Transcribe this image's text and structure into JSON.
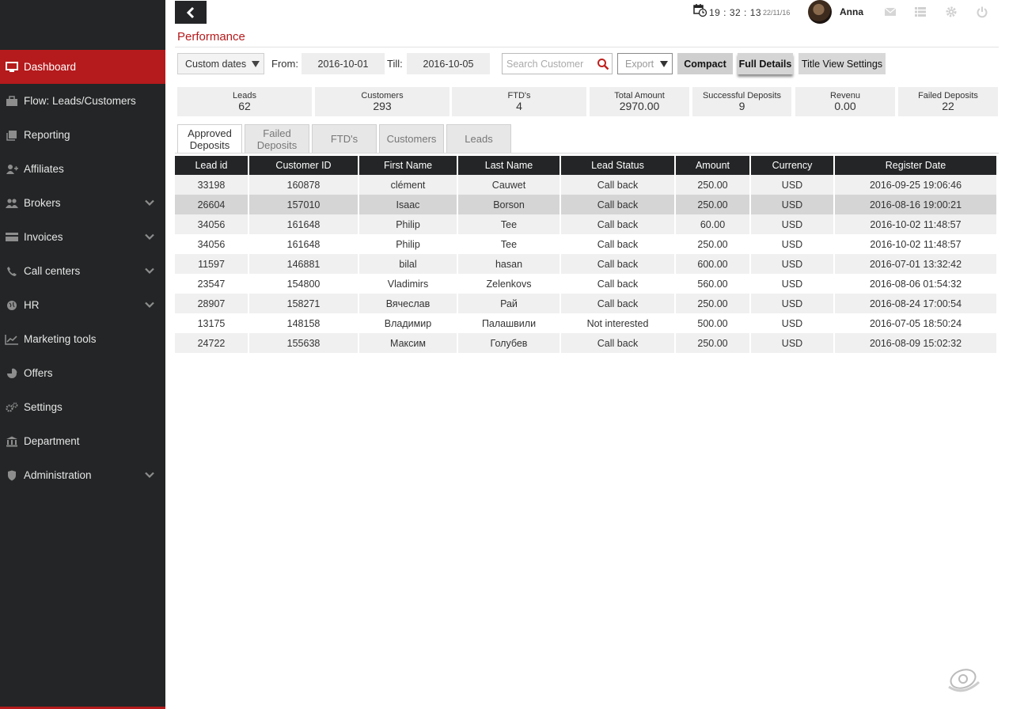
{
  "sidebar": {
    "items": [
      {
        "label": "Dashboard",
        "icon": "monitor-icon",
        "active": true,
        "expandable": false
      },
      {
        "label": "Flow: Leads/Customers",
        "icon": "briefcase-icon",
        "expandable": false
      },
      {
        "label": "Reporting",
        "icon": "book-icon",
        "expandable": false
      },
      {
        "label": "Affiliates",
        "icon": "user-plus-icon",
        "expandable": false
      },
      {
        "label": "Brokers",
        "icon": "users-icon",
        "expandable": true
      },
      {
        "label": "Invoices",
        "icon": "credit-card-icon",
        "expandable": true
      },
      {
        "label": "Call centers",
        "icon": "phone-icon",
        "expandable": true
      },
      {
        "label": "HR",
        "icon": "globe-icon",
        "expandable": true
      },
      {
        "label": "Marketing tools",
        "icon": "line-chart-icon",
        "expandable": false
      },
      {
        "label": "Offers",
        "icon": "pie-chart-icon",
        "expandable": false
      },
      {
        "label": "Settings",
        "icon": "gears-icon",
        "expandable": false
      },
      {
        "label": "Department",
        "icon": "bank-icon",
        "expandable": false
      },
      {
        "label": "Administration",
        "icon": "shield-icon",
        "expandable": true
      }
    ]
  },
  "header": {
    "time": "19 : 32 : 13",
    "date": "22/11/16",
    "username": "Anna",
    "icons": [
      "calendar-clock-icon",
      "mail-icon",
      "list-icon",
      "gear-icon",
      "power-icon"
    ]
  },
  "page": {
    "title": "Performance"
  },
  "filters": {
    "range_select": "Custom dates",
    "from_label": "From:",
    "from_value": "2016-10-01",
    "till_label": "Till:",
    "till_value": "2016-10-05",
    "search_placeholder": "Search Customer",
    "export_label": "Export",
    "compact_label": "Compact",
    "full_details_label": "Full Details",
    "title_view_label": "Title View Settings"
  },
  "stats": [
    {
      "label": "Leads",
      "value": "62"
    },
    {
      "label": "Customers",
      "value": "293"
    },
    {
      "label": "FTD's",
      "value": "4"
    },
    {
      "label": "Total Amount",
      "value": "2970.00"
    },
    {
      "label": "Successful Deposits",
      "value": "9"
    },
    {
      "label": "Revenu",
      "value": "0.00"
    },
    {
      "label": "Failed Deposits",
      "value": "22"
    }
  ],
  "tabs": [
    {
      "line1": "Approved",
      "line2": "Deposits",
      "active": true
    },
    {
      "line1": "Failed",
      "line2": "Deposits",
      "active": false
    },
    {
      "line1": "FTD's",
      "line2": "",
      "active": false
    },
    {
      "line1": "Customers",
      "line2": "",
      "active": false
    },
    {
      "line1": "Leads",
      "line2": "",
      "active": false
    }
  ],
  "table": {
    "columns": [
      "Lead id",
      "Customer ID",
      "First Name",
      "Last Name",
      "Lead Status",
      "Amount",
      "Currency",
      "Register Date"
    ],
    "rows": [
      [
        "33198",
        "160878",
        "clément",
        "Cauwet",
        "Call back",
        "250.00",
        "USD",
        "2016-09-25 19:06:46"
      ],
      [
        "26604",
        "157010",
        "Isaac",
        "Borson",
        "Call back",
        "250.00",
        "USD",
        "2016-08-16 19:00:21"
      ],
      [
        "34056",
        "161648",
        "Philip",
        "Tee",
        "Call back",
        "60.00",
        "USD",
        "2016-10-02 11:48:57"
      ],
      [
        "34056",
        "161648",
        "Philip",
        "Tee",
        "Call back",
        "250.00",
        "USD",
        "2016-10-02 11:48:57"
      ],
      [
        "11597",
        "146881",
        "bilal",
        "hasan",
        "Call back",
        "600.00",
        "USD",
        "2016-07-01 13:32:42"
      ],
      [
        "23547",
        "154800",
        "Vladimirs",
        "Zelenkovs",
        "Call back",
        "560.00",
        "USD",
        "2016-08-06 01:54:32"
      ],
      [
        "28907",
        "158271",
        "Вячеслав",
        "Рай",
        "Call back",
        "250.00",
        "USD",
        "2016-08-24 17:00:54"
      ],
      [
        "13175",
        "148158",
        "Владимир",
        "Палашвили",
        "Not interested",
        "500.00",
        "USD",
        "2016-07-05 18:50:24"
      ],
      [
        "24722",
        "155638",
        "Максим",
        "Голубев",
        "Call back",
        "250.00",
        "USD",
        "2016-08-09 15:02:32"
      ]
    ],
    "selected_row": 1
  },
  "colors": {
    "accent": "#b51a1c",
    "sidebar_bg": "#232526",
    "header_cell": "#232526"
  }
}
